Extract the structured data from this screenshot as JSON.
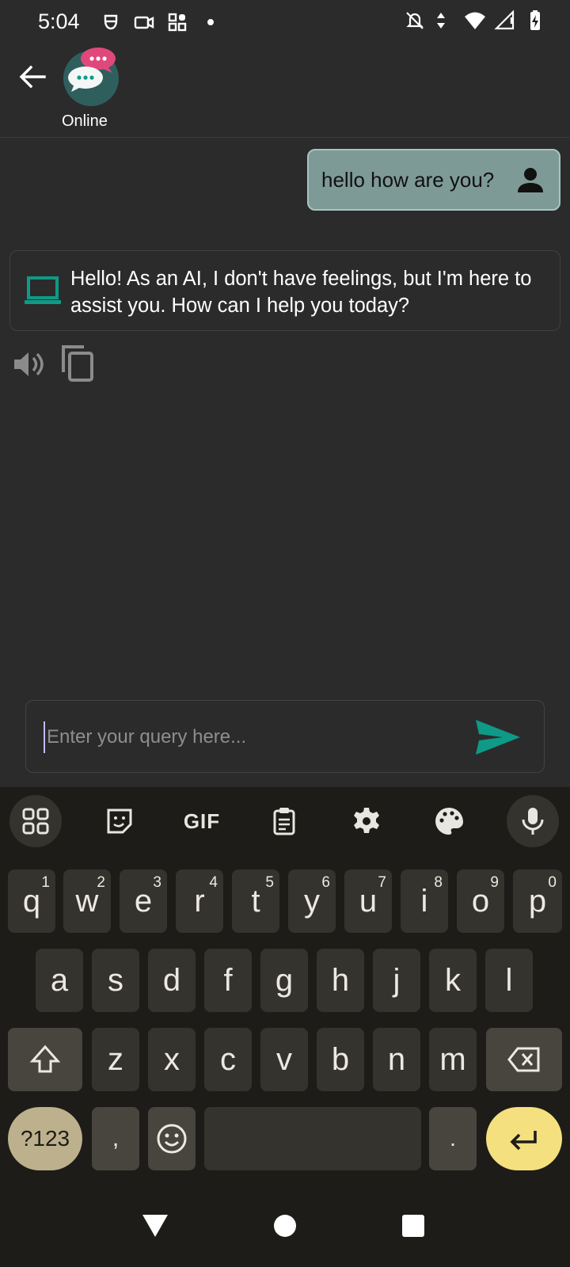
{
  "status_bar": {
    "time": "5:04",
    "left_icons": [
      "face-id-icon",
      "video-camera-icon",
      "grid-apps-icon",
      "dot-icon"
    ],
    "right_icons": [
      "bell-off-icon",
      "data-arrows-icon",
      "wifi-icon",
      "signal-icon",
      "battery-charging-icon"
    ]
  },
  "header": {
    "status_label": "Online",
    "avatar_icon": "chat-bubbles-icon"
  },
  "chat": {
    "user_message": "hello how are you?",
    "ai_message": "Hello! As an AI, I don't have feelings, but I'm here to assist you. How can I help you today?"
  },
  "input": {
    "placeholder": "Enter your query here...",
    "value": ""
  },
  "keyboard": {
    "toolbar": {
      "gif_label": "GIF"
    },
    "row1": [
      {
        "key": "q",
        "hint": "1"
      },
      {
        "key": "w",
        "hint": "2"
      },
      {
        "key": "e",
        "hint": "3"
      },
      {
        "key": "r",
        "hint": "4"
      },
      {
        "key": "t",
        "hint": "5"
      },
      {
        "key": "y",
        "hint": "6"
      },
      {
        "key": "u",
        "hint": "7"
      },
      {
        "key": "i",
        "hint": "8"
      },
      {
        "key": "o",
        "hint": "9"
      },
      {
        "key": "p",
        "hint": "0"
      }
    ],
    "row2": [
      "a",
      "s",
      "d",
      "f",
      "g",
      "h",
      "j",
      "k",
      "l"
    ],
    "row3": [
      "z",
      "x",
      "c",
      "v",
      "b",
      "n",
      "m"
    ],
    "symbols_label": "?123",
    "comma_label": ",",
    "period_label": "."
  },
  "colors": {
    "accent_teal": "#0e9a86",
    "user_bubble": "#7e9a96",
    "enter_key": "#f4e07f",
    "symbols_key": "#bdb08d",
    "avatar_badge": "#e0487c"
  }
}
